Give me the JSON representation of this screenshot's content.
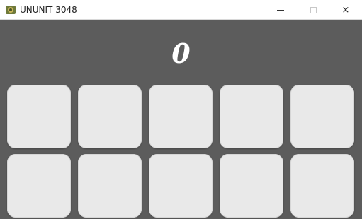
{
  "window": {
    "title": "UNUNIT 3048",
    "controls": {
      "minimize_icon": "minimize-icon",
      "maximize_icon": "maximize-icon",
      "close_label": "×"
    }
  },
  "game": {
    "score": "0",
    "tiles": [
      "",
      "",
      "",
      "",
      "",
      "",
      "",
      "",
      "",
      ""
    ]
  },
  "colors": {
    "background": "#5c5c5c",
    "tile": "#e9e9e9",
    "score_text": "#ffffff"
  }
}
